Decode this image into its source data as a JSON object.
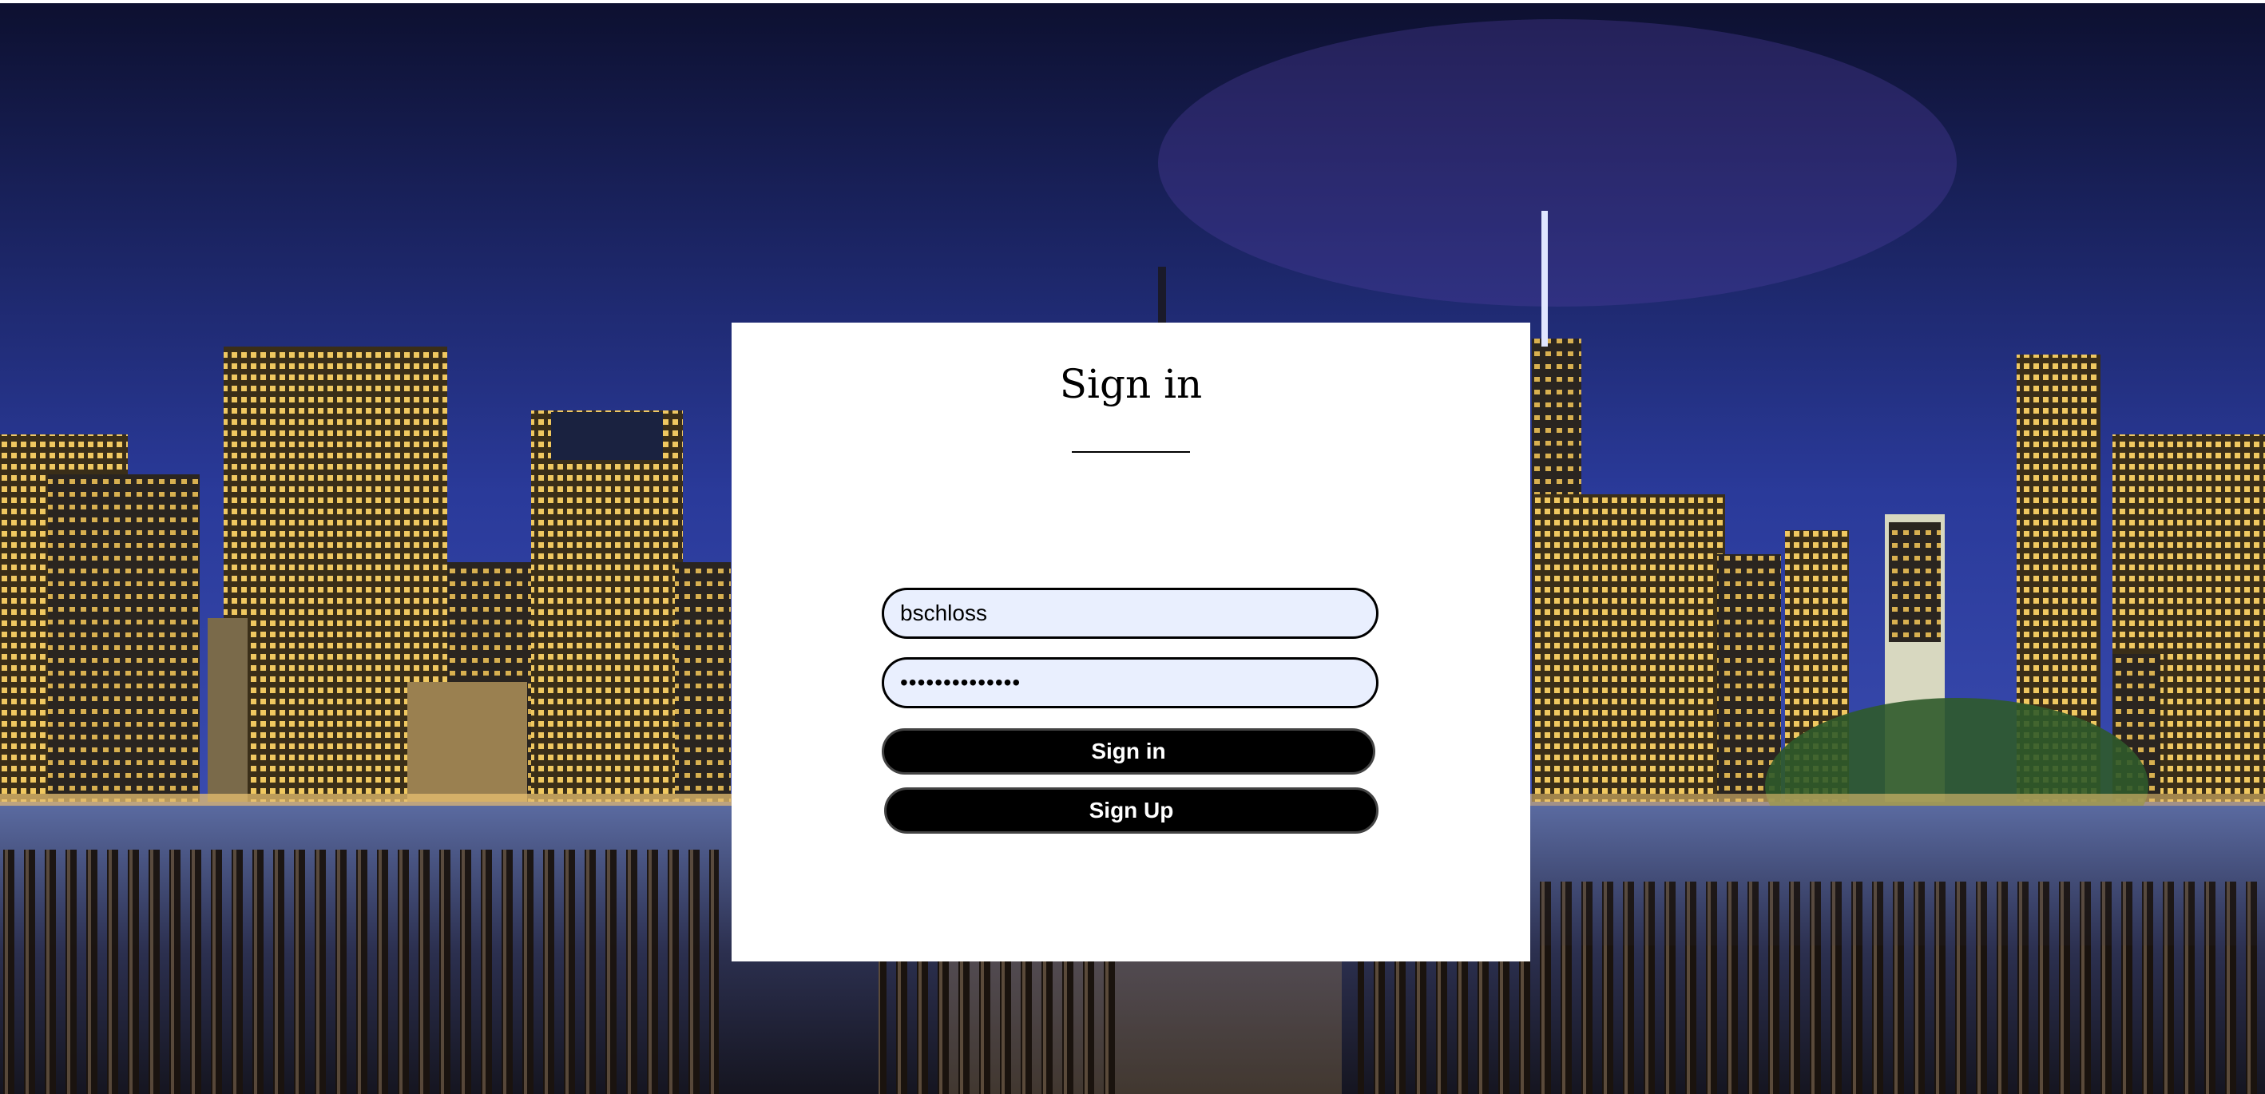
{
  "background": {
    "description_icon": "city-skyline-night-icon",
    "sky_top": "#0d1030",
    "sky_mid": "#2a3a9a",
    "water": "#4a5a8a",
    "lights": "#f0c060"
  },
  "signin_form": {
    "title": "Sign in",
    "username_value": "bschloss",
    "password_value": "••••••••••••••",
    "signin_label": "Sign in",
    "signup_label": "Sign Up"
  },
  "colors": {
    "field_bg": "#e9effe",
    "button_bg": "#000000",
    "button_text": "#ffffff"
  }
}
